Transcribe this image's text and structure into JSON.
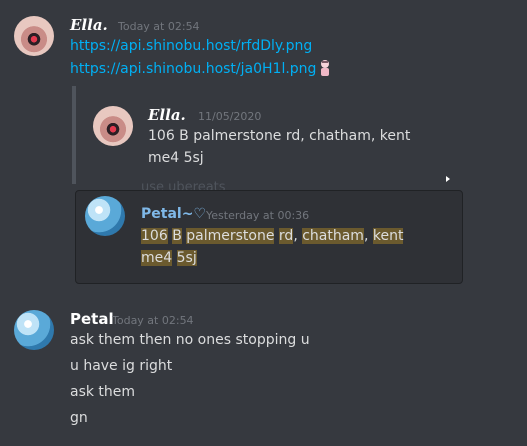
{
  "messages": [
    {
      "author": "𝑬𝒍𝒍𝒂.",
      "timestamp": "Today at 02:54",
      "links": [
        "https://api.shinobu.host/rfdDly.png",
        "https://api.shinobu.host/ja0H1l.png"
      ]
    }
  ],
  "reply_quote": {
    "author": "𝑬𝒍𝒍𝒂.",
    "timestamp": "11/05/2020",
    "text_line1": "106 B palmerstone rd, chatham, kent",
    "text_line2": "me4 5sj"
  },
  "ghost_text": "use ubereats",
  "embed": {
    "author": "Petal",
    "author_suffix": "~",
    "timestamp": "Yesterday at 00:36",
    "line1_words": [
      "106",
      "B",
      "palmerstone",
      "rd",
      "chatham",
      "kent"
    ],
    "line2_words": [
      "me4",
      "5sj"
    ]
  },
  "petal_message": {
    "author": "Petal",
    "timestamp": "Today at 02:54",
    "lines": [
      "ask them then no ones stopping u",
      "u have ig right",
      "ask them",
      "gn"
    ]
  },
  "colors": {
    "background": "#36393f",
    "link": "#00b0f4",
    "highlight": "#6b5a2e",
    "petal_name": "#7fb8e8"
  }
}
